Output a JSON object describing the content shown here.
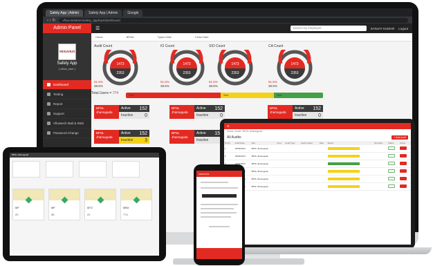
{
  "browser": {
    "tabs": [
      "Safety App | Admin",
      "Safety App | Admin",
      "Google"
    ],
    "url": "vflow.in/admin/safety_app/bpsl/dashboard"
  },
  "sidebar": {
    "header": "Admin Panel",
    "logo_text": "VESUVIUS",
    "app_name": "Safety App",
    "user_id": "[ vflow_user ]",
    "items": [
      "Dashboard",
      "Testing",
      "Report",
      "Support",
      "Vflowtech Mail & SMS",
      "Password Change"
    ]
  },
  "topbar": {
    "search_placeholder": "Search by employee",
    "user": "SANJAY KUMAR",
    "logout": "Logout"
  },
  "filters": [
    "Home",
    "BENA",
    "Types Date",
    "Close Date"
  ],
  "counts": [
    {
      "label": "Audit Count",
      "top": "1473",
      "bottom": "2353",
      "red_pct": "61.5%",
      "grey_pct": "38.5%"
    },
    {
      "label": "IO Count",
      "top": "1473",
      "bottom": "2353",
      "red_pct": "61.5%",
      "grey_pct": "38.5%"
    },
    {
      "label": "SIO Count",
      "top": "1473",
      "bottom": "2353",
      "red_pct": "61.5%",
      "grey_pct": "38.5%"
    },
    {
      "label": "CA Count",
      "top": "1473",
      "bottom": "2353",
      "red_pct": "61.5%",
      "grey_pct": "38.5%"
    }
  ],
  "total_users": {
    "label": "Total Users = ",
    "value": "774"
  },
  "progress": {
    "segments": [
      {
        "label": "Text",
        "fraction": 0.48,
        "color": "#e32a22"
      },
      {
        "label": "Text",
        "fraction": 0.27,
        "color": "#f3d219"
      },
      {
        "label": "Text",
        "fraction": 0.25,
        "color": "#43a047"
      }
    ]
  },
  "plant_cards": [
    {
      "line1": "BPSL",
      "line2": "Jharsuguda",
      "active_label": "Active",
      "active": "152",
      "inactive_label": "Inactive",
      "inactive": "0",
      "yellow": false
    },
    {
      "line1": "BPSL",
      "line2": "Jharsuguda",
      "active_label": "Active",
      "active": "152",
      "inactive_label": "Inactive",
      "inactive": "0",
      "yellow": false
    },
    {
      "line1": "BPSL",
      "line2": "Jharsuguda",
      "active_label": "Active",
      "active": "152",
      "inactive_label": "Inactive",
      "inactive": "0",
      "yellow": false
    },
    {
      "line1": "BPSL",
      "line2": "Jharsuguda",
      "active_label": "Active",
      "active": "152",
      "inactive_label": "Inactive",
      "inactive": "3",
      "yellow": true
    },
    {
      "line1": "BPSL",
      "line2": "Jharsuguda",
      "active_label": "Active",
      "active": "152",
      "inactive_label": "Inactive",
      "inactive": "0",
      "yellow": false
    }
  ],
  "laptop": {
    "breadcrumb": "Home / Audit / BPSL Jharsuguda",
    "title": "All Audits",
    "add_button": "+ Add Audit",
    "columns": [
      "Sr.No.",
      "Audit Date",
      "Site",
      "Area",
      "Audit Type",
      "Audit Leader",
      "Date",
      "Status",
      "Remarks",
      "Status",
      "Action"
    ],
    "rows": [
      {
        "no": "1",
        "date": "18/09/2023",
        "site": "BPSL Jharsuguda",
        "hl": "#f3d219"
      },
      {
        "no": "2",
        "date": "18/09/2023",
        "site": "BPSL Jharsuguda",
        "hl": "#f3d219"
      },
      {
        "no": "3",
        "date": "18/09/2023",
        "site": "BPSL Jharsuguda",
        "hl": "#43a047"
      },
      {
        "no": "4",
        "date": "18/09/2023",
        "site": "BPSL Jharsuguda",
        "hl": "#f3d219"
      },
      {
        "no": "5",
        "date": "18/09/2023",
        "site": "BPSL Jharsuguda",
        "hl": "#f3d219"
      },
      {
        "no": "6",
        "date": "18/09/2023",
        "site": "BPSL Jharsuguda",
        "hl": "#f3d219"
      }
    ]
  },
  "tablet": {
    "header": "BPSL Jharsuguda",
    "cards": [
      {
        "code": "MF",
        "num": "20"
      },
      {
        "code": "MF",
        "num": "56"
      },
      {
        "code": "MT2",
        "num": "22"
      },
      {
        "code": "MB3",
        "num": "774"
      }
    ]
  },
  "phone": {
    "header": "VESUVIUS"
  }
}
